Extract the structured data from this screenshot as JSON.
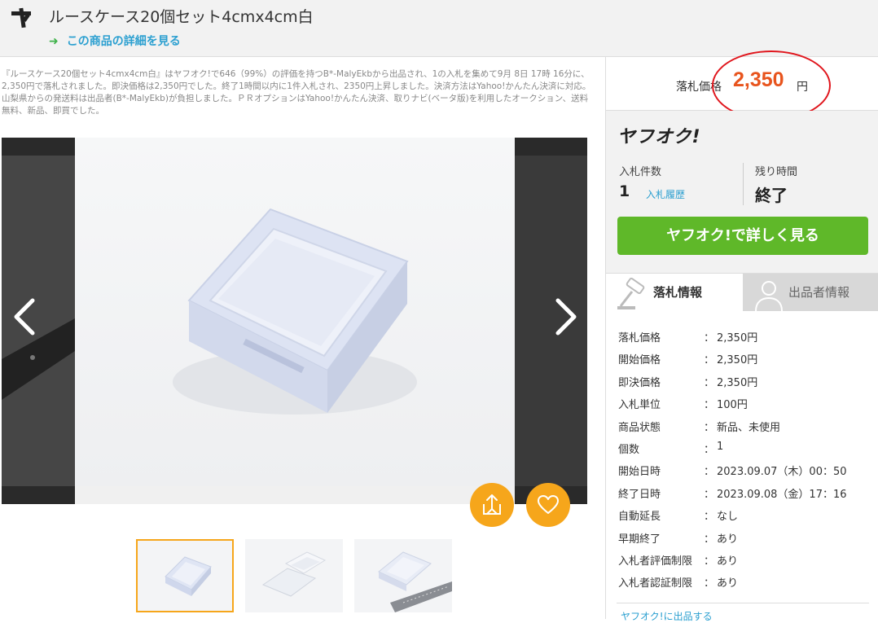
{
  "header": {
    "title": "ルースケース20個セット4cmx4cm白",
    "detail_link": "この商品の詳細を見る",
    "arrow": "➜"
  },
  "description": "『ルースケース20個セット4cmx4cm白』はヤフオク!で646（99%）の評価を持つB*-MalyEkbから出品され、1の入札を集めて9月 8日 17時 16分に、2,350円で落札されました。即決価格は2,350円でした。終了1時間以内に1件入札され、2350円上昇しました。決済方法はYahoo!かんたん決済に対応。山梨県からの発送料は出品者(B*-MalyEkb)が負担しました。ＰＲオプションはYahoo!かんたん決済、取りナビ(ベータ版)を利用したオークション、送料無料、新品、即買でした。",
  "price": {
    "label": "落札価格",
    "value": "2,350",
    "unit": "円",
    "color": "#e8541d",
    "ring_color": "#e0161d"
  },
  "yahoo": {
    "logo_text": "ヤフオク!",
    "bids_label": "入札件数",
    "bids_count": "1",
    "bids_history": "入札履歴",
    "remaining_label": "残り時間",
    "remaining_value": "終了",
    "cta": "ヤフオク!で詳しく見る",
    "cta_color": "#5fb829"
  },
  "tabs": [
    {
      "label": "落札情報",
      "active": true,
      "icon": "gavel-icon"
    },
    {
      "label": "出品者情報",
      "active": false,
      "icon": "person-icon"
    }
  ],
  "info_rows": [
    {
      "key": "落札価格",
      "value": "2,350円"
    },
    {
      "key": "開始価格",
      "value": "2,350円"
    },
    {
      "key": "即決価格",
      "value": "2,350円"
    },
    {
      "key": "入札単位",
      "value": "100円"
    },
    {
      "key": "商品状態",
      "value": "新品、未使用"
    },
    {
      "key": "個数",
      "value": "1"
    },
    {
      "key": "開始日時",
      "value": "2023.09.07（木）00：50"
    },
    {
      "key": "終了日時",
      "value": "2023.09.08（金）17：16"
    },
    {
      "key": "自動延長",
      "value": "なし"
    },
    {
      "key": "早期終了",
      "value": "あり"
    },
    {
      "key": "入札者評価制限",
      "value": "あり"
    },
    {
      "key": "入札者認証制限",
      "value": "あり"
    }
  ],
  "colon": "：",
  "bottom_link": "ヤフオク!に出品する",
  "accent_orange": "#f6a61b"
}
